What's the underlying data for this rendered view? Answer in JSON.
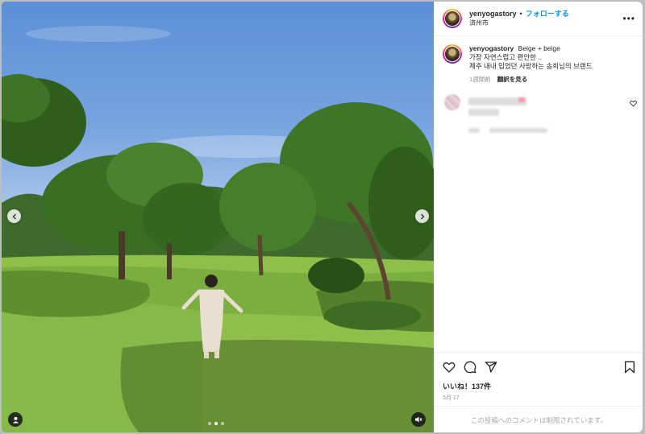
{
  "post": {
    "username": "yenyogastory",
    "follow_label": "フォローする",
    "location": "済州市",
    "more_label": "•••",
    "caption_title": "Beige + beige",
    "caption_lines": [
      "가장 자연스럽고 편안한 ..",
      "제주 내내 입었던 사랑하는 송희님의 브랜드"
    ],
    "time_ago": "1週間前",
    "translate_label": "翻訳を見る",
    "likes": "いいね！137件",
    "date": "5月 17",
    "comments_disabled": "この投稿へのコメントは制限されています。"
  },
  "icons": {
    "prev": "chevron-left-icon",
    "next": "chevron-right-icon",
    "user_tag": "user-icon",
    "mute": "speaker-muted-icon",
    "like": "heart-icon",
    "comment": "comment-icon",
    "share": "paper-plane-icon",
    "save": "bookmark-icon",
    "comment_like": "heart-small-icon"
  },
  "carousel": {
    "count": 3,
    "active_index": 1
  },
  "colors": {
    "link": "#0095f6",
    "text": "#262626",
    "muted": "#8e8e8e"
  }
}
